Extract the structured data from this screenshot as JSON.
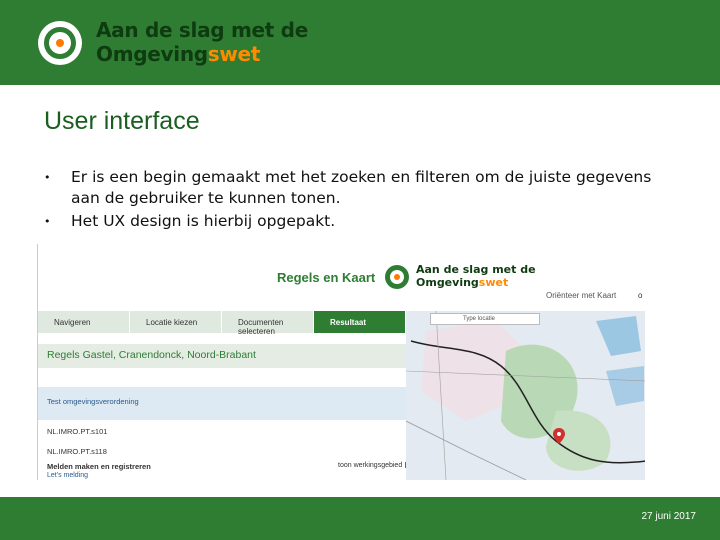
{
  "header": {
    "brand_line1": "Aan de slag met de",
    "brand_line2_main": "Omgeving",
    "brand_line2_accent": "swet",
    "colors": {
      "band": "#2e7d32",
      "accent": "#ff8a00"
    },
    "logo_icon": "omgevingswet-logo-icon"
  },
  "slide": {
    "title": "User interface",
    "bullets": [
      "Er is een begin gemaakt met het zoeken en filteren om de juiste gegevens aan de gebruiker te kunnen tonen.",
      "Het UX design is hierbij opgepakt."
    ]
  },
  "screenshot": {
    "app_name": "Regels en Kaart",
    "brand_line1": "Aan de slag met de",
    "brand_line2_main": "Omgeving",
    "brand_line2_accent": "swet",
    "orient_link": "Oriënteer met Kaart",
    "orient_o": "o",
    "steps": [
      "Navigeren",
      "Locatie kiezen",
      "Documenten selecteren",
      "Resultaat"
    ],
    "active_step": "Resultaat",
    "result_title": "Regels Gastel, Cranendonck, Noord-Brabant",
    "document_row": "Test omgevingsverordening",
    "codes": [
      "NL.IMRO.PT.s101",
      "NL.IMRO.PT.s118"
    ],
    "footer_label": "Melden maken en registreren",
    "footer_link": "Let's melding",
    "toon_label": "toon werkingsgebied",
    "search_placeholder": "Type locatie",
    "map_icon": "location-pin-icon"
  },
  "footer": {
    "date": "27 juni 2017"
  }
}
